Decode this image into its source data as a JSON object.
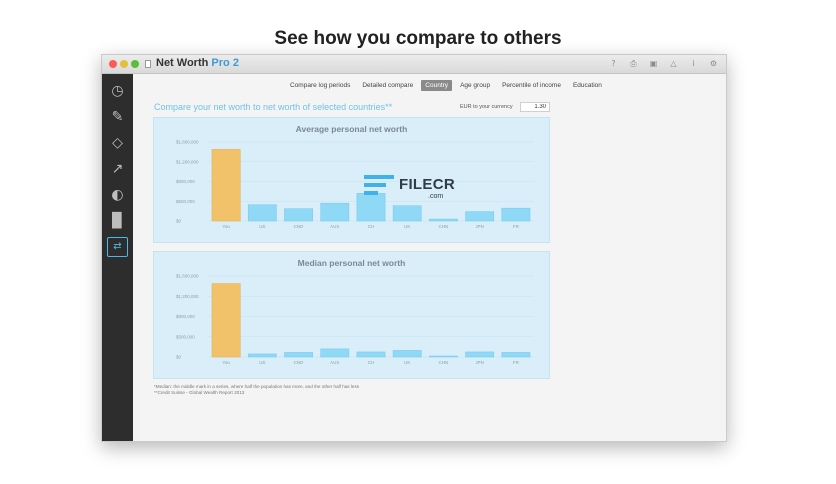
{
  "headline": "See how you compare to others",
  "window": {
    "title_main": "Net Worth",
    "title_accent": "Pro 2",
    "toolbar_icons": [
      "help-icon",
      "print-icon",
      "document-icon",
      "warning-icon",
      "info-icon",
      "gear-icon"
    ]
  },
  "sidebar": {
    "items": [
      {
        "icon": "speedometer-icon"
      },
      {
        "icon": "tag-icon"
      },
      {
        "icon": "price-tag-icon"
      },
      {
        "icon": "trend-line-icon"
      },
      {
        "icon": "pie-chart-icon"
      },
      {
        "icon": "bar-chart-icon"
      },
      {
        "icon": "compare-icon",
        "active": true
      }
    ]
  },
  "tabs": [
    {
      "label": "Compare log periods"
    },
    {
      "label": "Detailed compare"
    },
    {
      "label": "Country",
      "active": true
    },
    {
      "label": "Age group"
    },
    {
      "label": "Percentile of income"
    },
    {
      "label": "Education"
    }
  ],
  "subtitle": "Compare your net worth to net worth of selected countries**",
  "currency": {
    "label": "EUR to your currency",
    "value": "1.30"
  },
  "colors": {
    "you_bar": "#f2c26b",
    "country_bar": "#8fd8f6",
    "panel_bg": "#d9eef8",
    "accent": "#4fb6ea"
  },
  "chart_data": [
    {
      "type": "bar",
      "title": "Average personal net worth",
      "categories": [
        "You",
        "US",
        "CND",
        "AUS",
        "CH",
        "UK",
        "CHN",
        "JPN",
        "FR"
      ],
      "y_tick_labels": [
        "$0",
        "$500,000",
        "$800,000",
        "$1,200,000",
        "$1,600,000"
      ],
      "ylim": [
        0,
        1600000
      ],
      "values": [
        1450000,
        330000,
        250000,
        360000,
        560000,
        310000,
        40000,
        190000,
        260000
      ],
      "highlight_index": 0
    },
    {
      "type": "bar",
      "title": "Median personal net worth",
      "categories": [
        "You",
        "US",
        "CND",
        "AUS",
        "CH",
        "UK",
        "CHN",
        "JPN",
        "FR"
      ],
      "y_tick_labels": [
        "$0",
        "$500,000",
        "$800,000",
        "$1,200,000",
        "$1,600,000"
      ],
      "ylim": [
        0,
        1600000
      ],
      "values": [
        1450000,
        60000,
        90000,
        160000,
        100000,
        130000,
        20000,
        100000,
        90000
      ],
      "highlight_index": 0
    }
  ],
  "footnotes": [
    "*Median: the middle mark in a series, where half the population has more, and the other half has less",
    "**Credit Suisse - Global Wealth Report 2013"
  ],
  "watermark": {
    "text": "FILECR",
    "sub": ".com"
  }
}
